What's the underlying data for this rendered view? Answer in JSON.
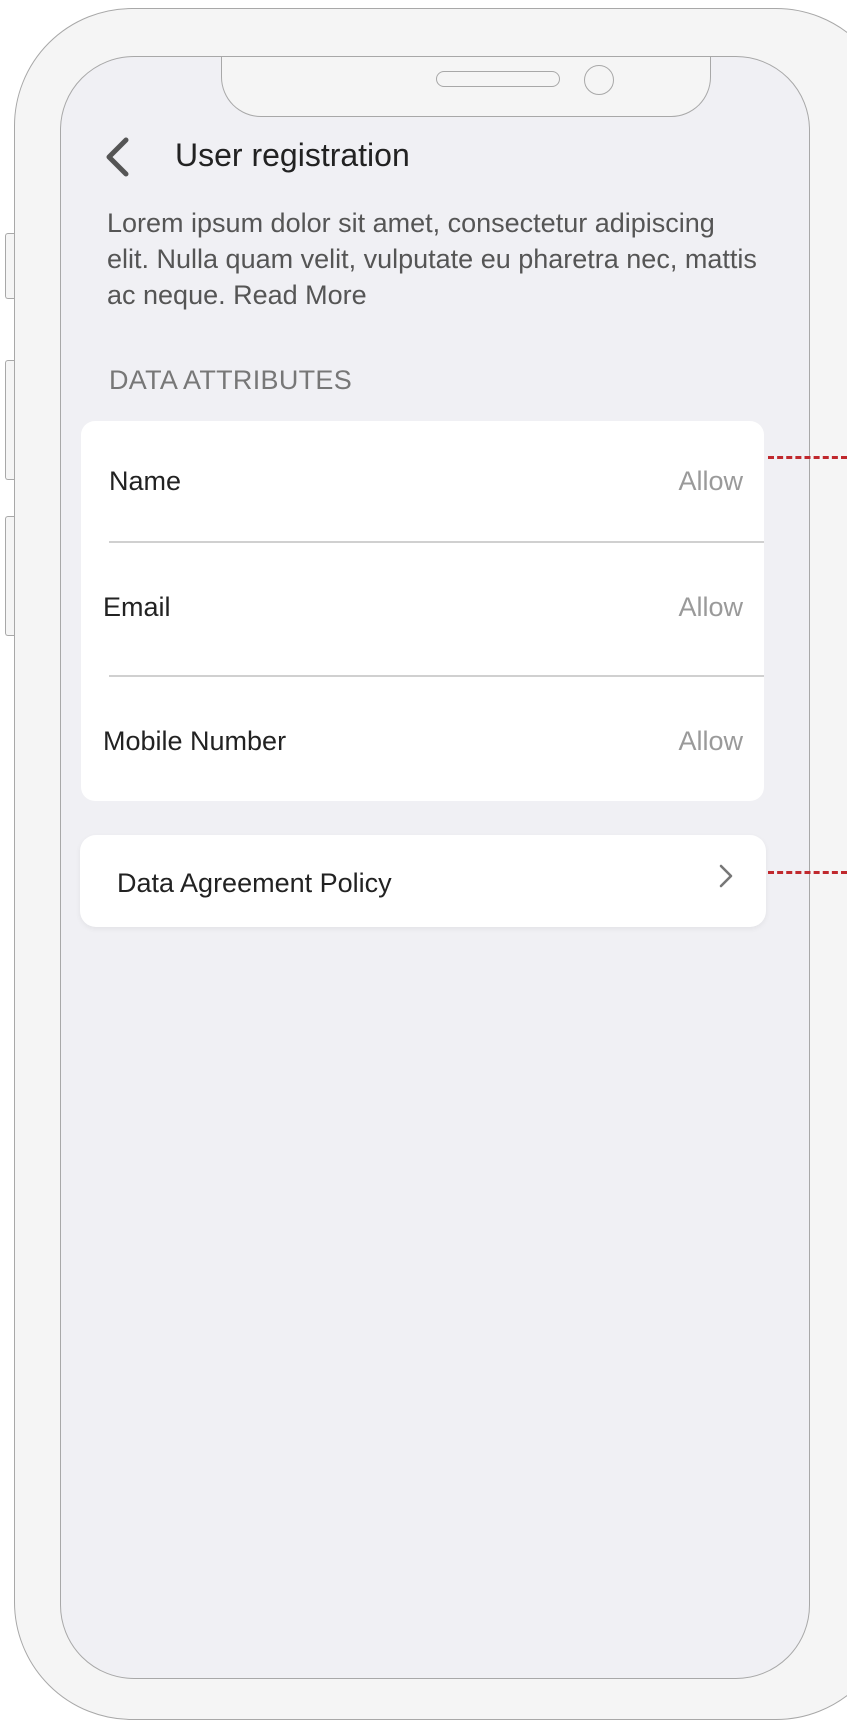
{
  "header": {
    "title": "User registration",
    "back_icon": "chevron-left-icon"
  },
  "intro": {
    "text": "Lorem ipsum dolor sit amet, consectetur adipiscing elit. Nulla quam velit, vulputate eu pharetra nec, mattis ac neque.",
    "read_more": "Read More"
  },
  "section": {
    "label": "DATA ATTRIBUTES"
  },
  "attributes": [
    {
      "label": "Name",
      "value": "Allow"
    },
    {
      "label": "Email",
      "value": "Allow"
    },
    {
      "label": "Mobile Number",
      "value": "Allow"
    }
  ],
  "policy": {
    "label": "Data Agreement Policy",
    "icon": "chevron-right-icon"
  },
  "colors": {
    "screen_bg": "#f0f0f4",
    "frame_outline": "#a8a8a8",
    "annotation_red": "#c0282d",
    "muted_text": "#9a9a9a"
  }
}
